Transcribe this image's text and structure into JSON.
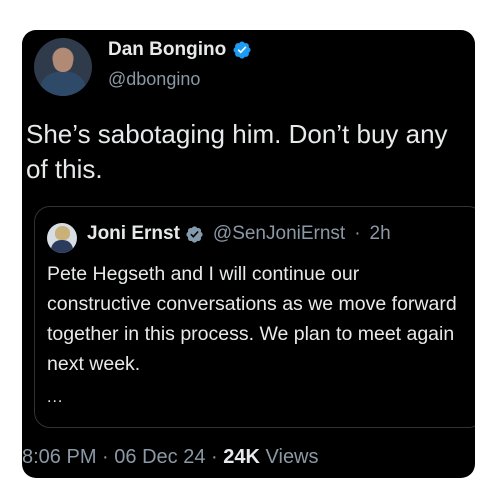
{
  "author": {
    "name": "Dan Bongino",
    "handle": "@dbongino",
    "verified_icon": "verified-badge-icon",
    "badge_color": "#1d9bf0"
  },
  "tweet": {
    "text": "She’s sabotaging him. Don’t buy any of this."
  },
  "quoted": {
    "name": "Joni Ernst",
    "handle": "@SenJoniErnst",
    "separator": "·",
    "age": "2h",
    "verified_icon": "verified-badge-icon",
    "badge_color": "#829aab",
    "text": "Pete Hegseth and I will continue our constructive conversations as we move forward together in this process. We plan to meet again next week.",
    "ellipsis": "..."
  },
  "meta": {
    "time": "8:06 PM",
    "sep1": "·",
    "date": "06 Dec 24",
    "sep2": "·",
    "views_count": "24K",
    "views_label": "Views"
  }
}
